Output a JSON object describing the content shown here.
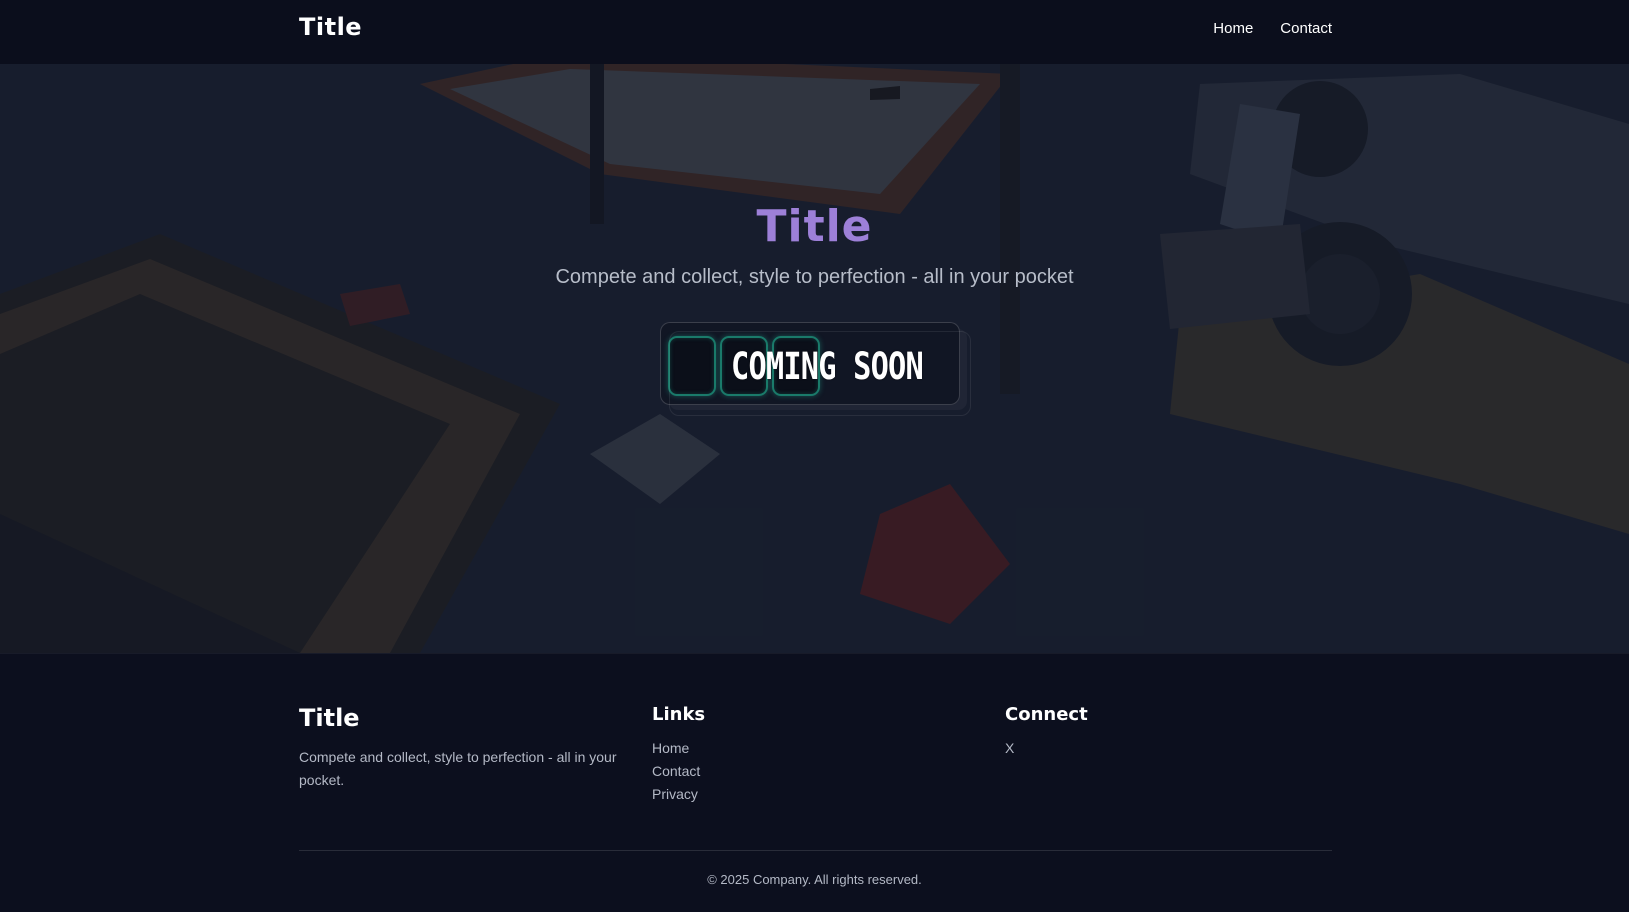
{
  "header": {
    "brand": "Title",
    "nav": [
      "Home",
      "Contact"
    ]
  },
  "hero": {
    "title": "Title",
    "subtitle": "Compete and collect, style to perfection - all in your pocket",
    "badge": "COMING SOON",
    "title_color": "#9d80d8",
    "tile_border_color": "#1a7a6a"
  },
  "footer": {
    "brand": "Title",
    "description": "Compete and collect, style to perfection - all in your pocket.",
    "links_heading": "Links",
    "links": [
      "Home",
      "Contact",
      "Privacy"
    ],
    "connect_heading": "Connect",
    "connect": [
      "X"
    ],
    "copyright": "© 2025 Company. All rights reserved."
  }
}
